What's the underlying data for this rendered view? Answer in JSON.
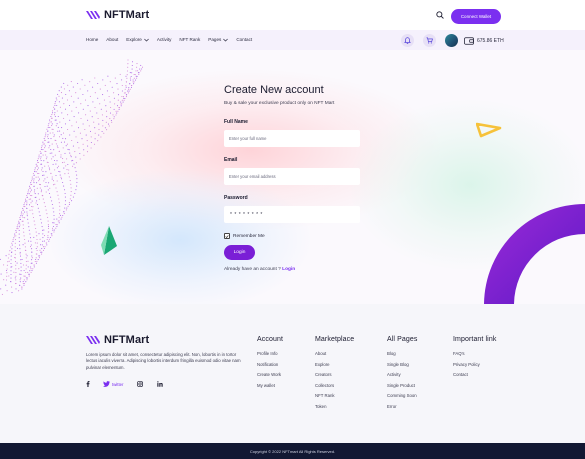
{
  "brand": {
    "name": "NFTMart"
  },
  "header": {
    "connect_label": "Connect Wallet"
  },
  "nav": {
    "links": [
      {
        "label": "Home"
      },
      {
        "label": "About"
      },
      {
        "label": "Explore"
      },
      {
        "label": "Activity"
      },
      {
        "label": "NFT Rank"
      },
      {
        "label": "Pages"
      },
      {
        "label": "Contact"
      }
    ],
    "balance": "675.86 ETH"
  },
  "form": {
    "title": "Create New account",
    "subtitle": "Buy & sale your exclusive product only on NFT Mart",
    "full_name_label": "Full Name",
    "full_name_placeholder": "Enter your full name",
    "email_label": "Email",
    "email_placeholder": "Enter your email address",
    "password_label": "Password",
    "password_mask": "********",
    "remember_label": "Remember Me",
    "remember_checked": true,
    "login_button": "Login",
    "already_text": "Already have an account ?",
    "login_link": "Login"
  },
  "footer": {
    "about": "Lorem ipsum dolor sit amet, consectetur adipiscing elit. Non, lobortis in in tortor lectus iaculis viverra. Adipiscing lobortis interdum fringilla euismod odio vitae nam pulvinar elementum.",
    "social_twitter": "twitter",
    "columns": [
      {
        "title": "Account",
        "items": [
          "Profile Info",
          "Notification",
          "Create Work",
          "My wallet"
        ]
      },
      {
        "title": "Marketplace",
        "items": [
          "About",
          "Explore",
          "Creators",
          "Collectors",
          "NFT Rank",
          "Token"
        ]
      },
      {
        "title": "All Pages",
        "items": [
          "Blog",
          "Single Blog",
          "Activity",
          "Single Product",
          "Comming Soon",
          "Error"
        ]
      },
      {
        "title": "Important link",
        "items": [
          "FAQ's",
          "Privacy Policy",
          "Contact"
        ]
      }
    ],
    "copyright": "Copyright © 2022 NFTmart All Rights Reserved."
  },
  "colors": {
    "accent": "#7b2ff0",
    "login_button": "#7a1fd6",
    "footer_bar": "#121833",
    "nav_bg": "#f5f1fc"
  },
  "icons": [
    "logo-mark-icon",
    "search-icon",
    "chevron-down-icon",
    "bell-icon",
    "cart-icon",
    "wallet-icon",
    "check-icon",
    "facebook-icon",
    "twitter-icon",
    "instagram-icon",
    "linkedin-icon"
  ]
}
